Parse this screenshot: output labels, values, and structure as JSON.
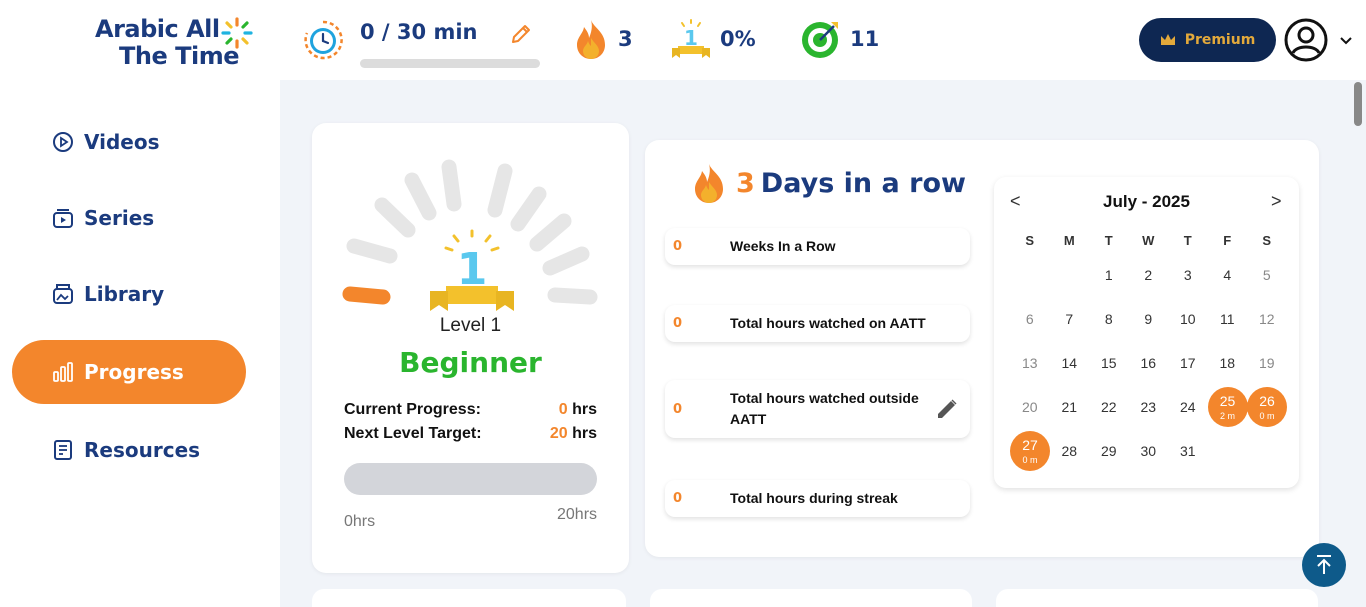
{
  "header": {
    "logo_line1": "Arabic All",
    "logo_line2": "The Time",
    "timer_text": "0 / 30 min",
    "timer_progress": 0,
    "streak_count": "3",
    "level_percent": "0%",
    "goal_count": "11",
    "premium_label": "Premium"
  },
  "sidebar": {
    "items": [
      {
        "label": "Videos",
        "icon": "play-circle-icon",
        "active": false
      },
      {
        "label": "Series",
        "icon": "series-icon",
        "active": false
      },
      {
        "label": "Library",
        "icon": "library-icon",
        "active": false
      },
      {
        "label": "Progress",
        "icon": "bar-chart-icon",
        "active": true
      },
      {
        "label": "Resources",
        "icon": "document-icon",
        "active": false
      }
    ]
  },
  "level_card": {
    "level_label": "Level 1",
    "level_name": "Beginner",
    "current_progress_label": "Current Progress:",
    "current_progress_value": "0",
    "current_progress_unit": "hrs",
    "next_target_label": "Next Level Target:",
    "next_target_value": "20",
    "next_target_unit": "hrs",
    "bar_min": "0hrs",
    "bar_max": "20hrs",
    "bar_progress": 0
  },
  "streak_card": {
    "streak_num": "3",
    "streak_text": "Days in a row",
    "stats": [
      {
        "value": "0",
        "label": "Weeks In a Row",
        "editable": false
      },
      {
        "value": "0",
        "label": "Total hours watched on AATT",
        "editable": false
      },
      {
        "value": "0",
        "label": "Total hours watched outside AATT",
        "editable": true
      },
      {
        "value": "0",
        "label": "Total hours during streak",
        "editable": false
      }
    ]
  },
  "calendar": {
    "prev": "<",
    "next": ">",
    "title": "July - 2025",
    "weekdays": [
      "S",
      "M",
      "T",
      "W",
      "T",
      "F",
      "S"
    ],
    "days": [
      {
        "d": "",
        "m": ""
      },
      {
        "d": "",
        "m": ""
      },
      {
        "d": "1",
        "m": ""
      },
      {
        "d": "2",
        "m": ""
      },
      {
        "d": "3",
        "m": ""
      },
      {
        "d": "4",
        "m": ""
      },
      {
        "d": "5",
        "m": ""
      },
      {
        "d": "6",
        "m": ""
      },
      {
        "d": "7",
        "m": ""
      },
      {
        "d": "8",
        "m": ""
      },
      {
        "d": "9",
        "m": ""
      },
      {
        "d": "10",
        "m": ""
      },
      {
        "d": "11",
        "m": ""
      },
      {
        "d": "12",
        "m": ""
      },
      {
        "d": "13",
        "m": ""
      },
      {
        "d": "14",
        "m": ""
      },
      {
        "d": "15",
        "m": ""
      },
      {
        "d": "16",
        "m": ""
      },
      {
        "d": "17",
        "m": ""
      },
      {
        "d": "18",
        "m": ""
      },
      {
        "d": "19",
        "m": ""
      },
      {
        "d": "20",
        "m": ""
      },
      {
        "d": "21",
        "m": ""
      },
      {
        "d": "22",
        "m": ""
      },
      {
        "d": "23",
        "m": ""
      },
      {
        "d": "24",
        "m": ""
      },
      {
        "d": "25",
        "m": "2 m",
        "active": true
      },
      {
        "d": "26",
        "m": "0 m",
        "active": true
      },
      {
        "d": "27",
        "m": "0 m",
        "active": true
      },
      {
        "d": "28",
        "m": ""
      },
      {
        "d": "29",
        "m": ""
      },
      {
        "d": "30",
        "m": ""
      },
      {
        "d": "31",
        "m": ""
      },
      {
        "d": "",
        "m": ""
      },
      {
        "d": "",
        "m": ""
      }
    ]
  },
  "colors": {
    "accent": "#f3862c",
    "navy": "#1b3b7e",
    "green": "#2ab52e",
    "premium_bg": "#0e2752",
    "premium_text": "#e3a93b"
  }
}
